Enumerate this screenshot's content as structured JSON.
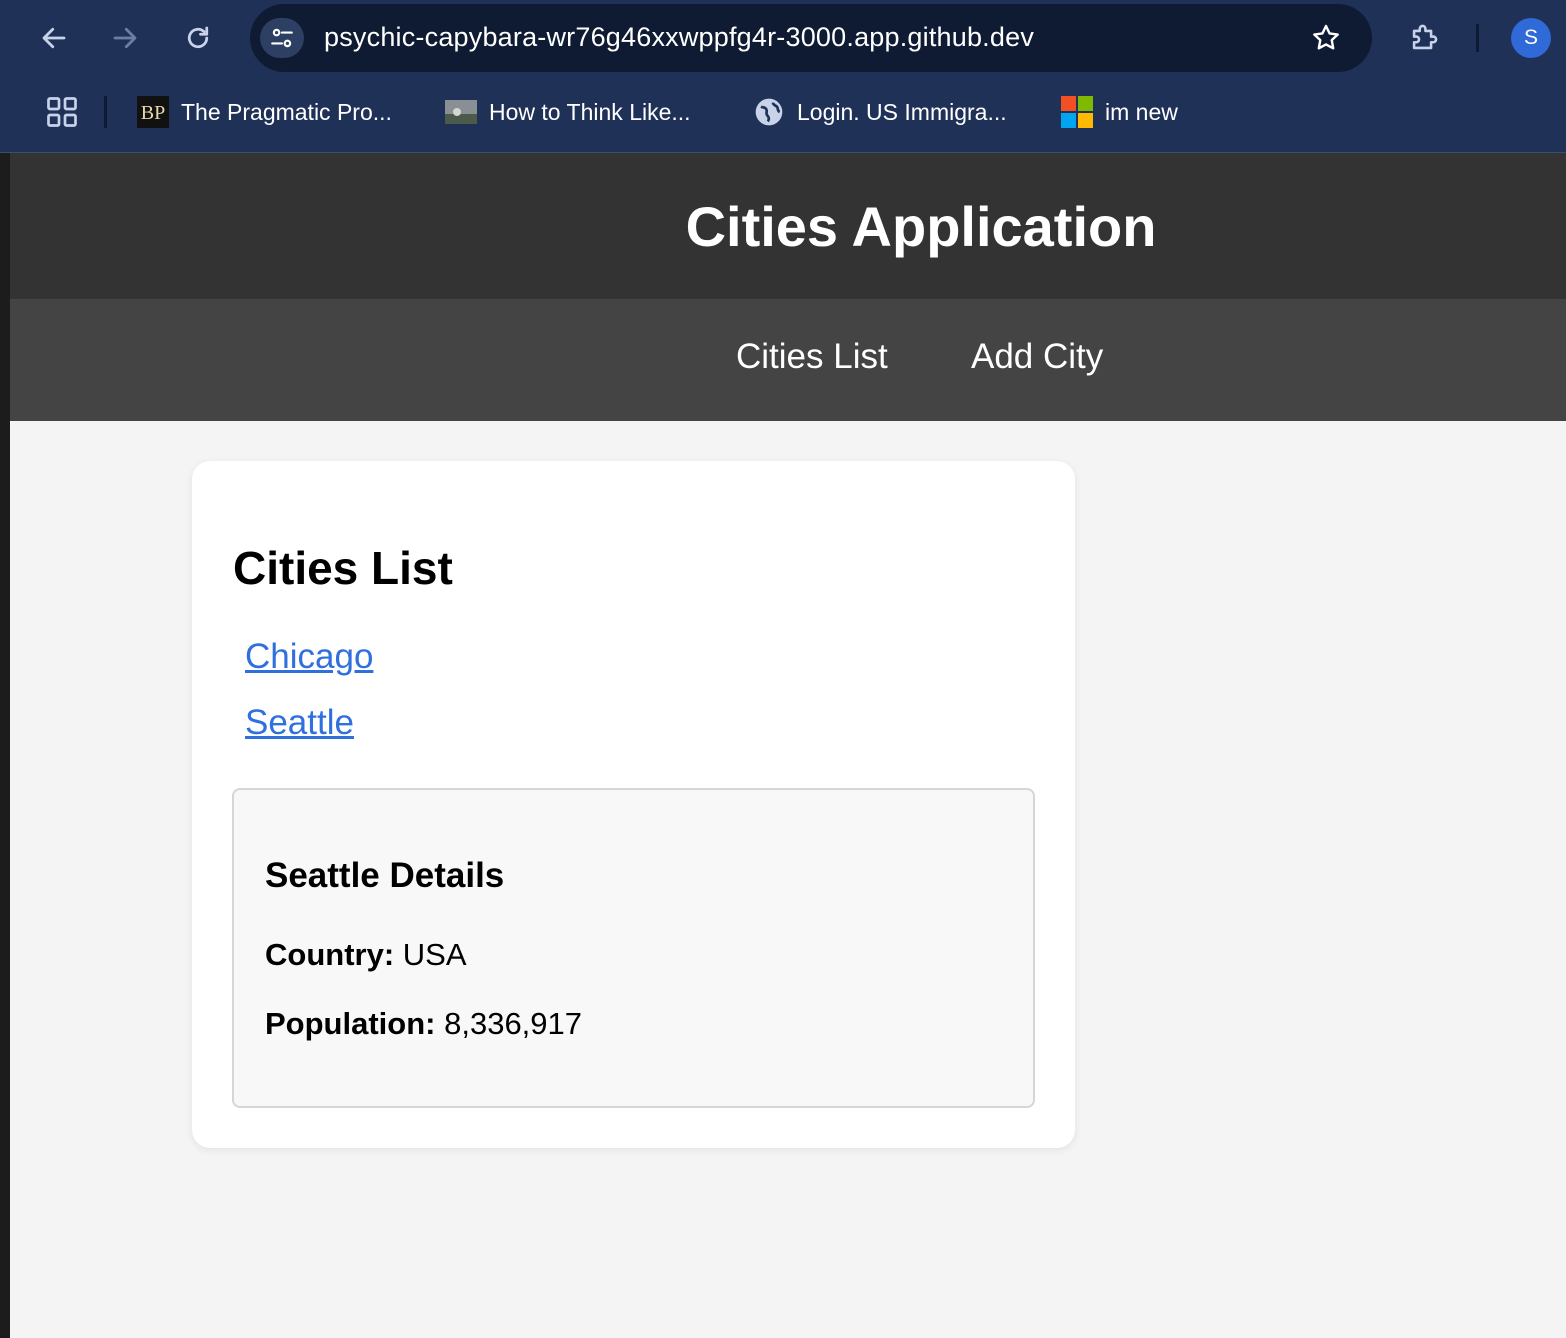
{
  "browser": {
    "url": "psychic-capybara-wr76g46xxwppfg4r-3000.app.github.dev",
    "profile_initial": "S",
    "bookmarks": [
      {
        "label": "The Pragmatic Pro...",
        "icon": "pragmatic-bookshelf-icon"
      },
      {
        "label": "How to Think Like...",
        "icon": "thumbnail-icon"
      },
      {
        "label": "Login. US Immigra...",
        "icon": "globe-icon"
      },
      {
        "label": "im new",
        "icon": "microsoft-icon"
      }
    ]
  },
  "app": {
    "title": "Cities Application",
    "nav": [
      {
        "label": "Cities List"
      },
      {
        "label": "Add City"
      }
    ]
  },
  "main": {
    "heading": "Cities List",
    "cities": [
      {
        "name": "Chicago"
      },
      {
        "name": "Seattle"
      }
    ],
    "details": {
      "title": "Seattle Details",
      "country_label": "Country:",
      "country": "USA",
      "population_label": "Population:",
      "population": "8,336,917"
    }
  },
  "colors": {
    "chrome": "#1f3157",
    "header": "#333333",
    "nav": "#444444",
    "link": "#2f6fde"
  }
}
